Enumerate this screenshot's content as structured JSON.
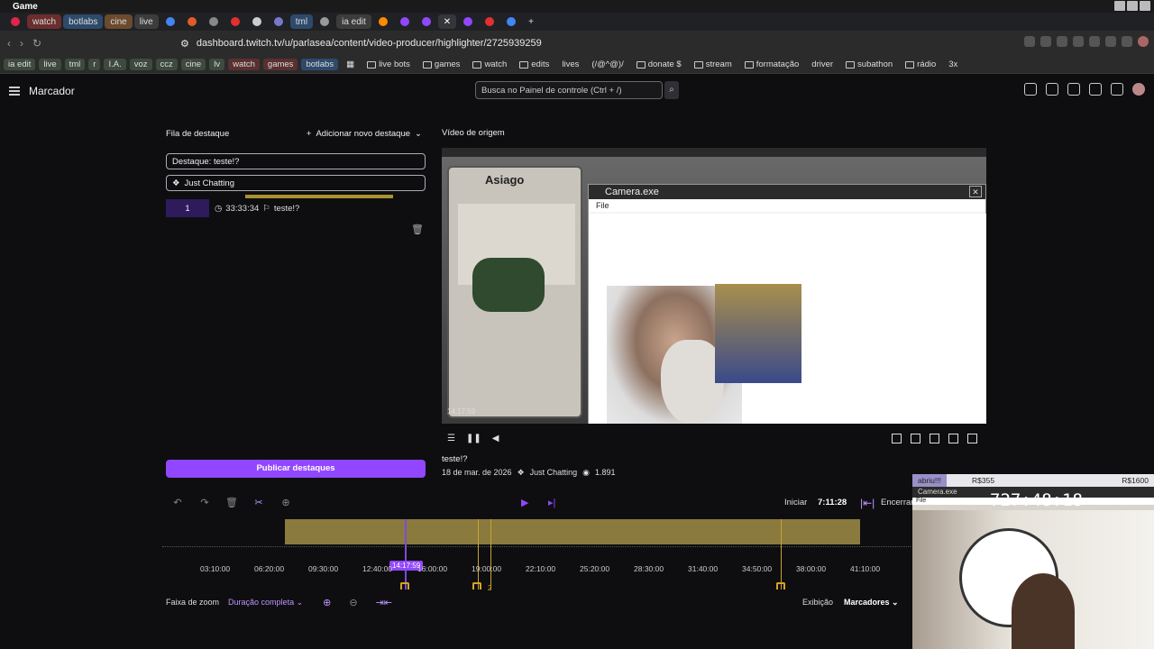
{
  "window": {
    "title": "Game"
  },
  "tabs": [
    {
      "label": "watch",
      "color": "#6b2e2e"
    },
    {
      "label": "botlabs",
      "color": "#2e4a6b"
    },
    {
      "label": "cine",
      "color": "#6b4a2e"
    },
    {
      "label": "live",
      "color": "#3c3c3c"
    },
    {
      "label": "tml",
      "color": "#2e4a6b"
    },
    {
      "label": "ia edit",
      "color": "#3c3c3c"
    }
  ],
  "address": {
    "url": "dashboard.twitch.tv/u/parlasea/content/video-producer/highlighter/2725939259"
  },
  "bookmarks": [
    "ia edit",
    "live",
    "tml",
    "r",
    "I.A.",
    "voz",
    "ccz",
    "cine",
    "lv",
    "watch",
    "games",
    "botlabs",
    "live bots",
    "games",
    "watch",
    "edits",
    "lives",
    "(/@^@)/",
    "donate $",
    "stream",
    "formatação",
    "driver",
    "subathon",
    "rádio",
    "3x"
  ],
  "topnav": {
    "title": "Marcador",
    "search_placeholder": "Busca no Painel de controle (Ctrl + /)"
  },
  "left": {
    "header": "Fila de destaque",
    "add_label": "Adicionar novo destaque",
    "title_field": "Destaque: teste!?",
    "category": "Just Chatting",
    "item": {
      "index": "1",
      "time": "33:33:34",
      "name": "teste!?"
    },
    "publish": "Publicar destaques"
  },
  "right": {
    "header": "Vídeo de origem",
    "game_name": "Asiago",
    "cam_window": "Camera.exe",
    "cam_menu": "File",
    "time_overlay": "14:17:59",
    "info": {
      "title": "teste!?",
      "date": "18 de mar. de 2026",
      "category": "Just Chatting",
      "views": "1.891"
    }
  },
  "timeline": {
    "start_label": "Iniciar",
    "start_time": "7:11:28",
    "end_label": "Encerrar",
    "ticks": [
      "03:10:00",
      "06:20:00",
      "09:30:00",
      "12:40:00",
      "16:00:00",
      "19:00:00",
      "22:10:00",
      "25:20:00",
      "28:30:00",
      "31:40:00",
      "34:50:00",
      "38:00:00",
      "41:10:00"
    ],
    "playhead": "14:17:59",
    "marker_count": "2"
  },
  "zoom": {
    "label": "Faixa de zoom",
    "select": "Duração completa",
    "view_label": "Exibição",
    "view_select": "Marcadores"
  },
  "webcam": {
    "user": "abriu!!!",
    "cost1": "R$355",
    "cost2": "R$1600",
    "window": "Camera.exe",
    "clock": "727:48:18",
    "file": "File"
  }
}
